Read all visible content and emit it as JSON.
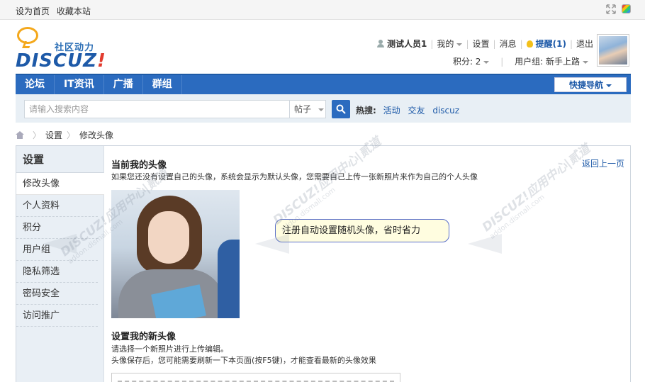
{
  "topbar": {
    "set_home": "设为首页",
    "bookmark": "收藏本站"
  },
  "logo": {
    "tagline": "社区动力",
    "wordmark": "DISCUZ",
    "bang": "!"
  },
  "user": {
    "name": "测试人员1",
    "mine": "我的",
    "settings": "设置",
    "messages": "消息",
    "remind": "提醒(1)",
    "logout": "退出",
    "points": "积分: 2",
    "usergroup": "用户组: 新手上路"
  },
  "nav": {
    "items": [
      "论坛",
      "IT资讯",
      "广播",
      "群组"
    ],
    "quick": "快捷导航"
  },
  "search": {
    "placeholder": "请输入搜索内容",
    "type": "帖子",
    "hot_label": "热搜:",
    "hot": [
      "活动",
      "交友",
      "discuz"
    ]
  },
  "breadcrumb": [
    "设置",
    "修改头像"
  ],
  "sidebar": {
    "title": "设置",
    "items": [
      "修改头像",
      "个人资料",
      "积分",
      "用户组",
      "隐私筛选",
      "密码安全",
      "访问推广"
    ]
  },
  "content": {
    "current_title": "当前我的头像",
    "current_desc": "如果您还没有设置自己的头像，系统会显示为默认头像，您需要自己上传一张新照片来作为自己的个人头像",
    "back": "返回上一页",
    "tooltip": "注册自动设置随机头像，省时省力",
    "new_title": "设置我的新头像",
    "new_desc1": "请选择一个新照片进行上传编辑。",
    "new_desc2": "头像保存后，您可能需要刷新一下本页面(按F5键)，才能查看最新的头像效果"
  },
  "watermark": {
    "text": "DISCUZ!应用中心|贰道",
    "sub": "addon.dismall.com"
  },
  "colors": {
    "nav_blue": "#2b6bbf",
    "link_blue": "#1e5aa8",
    "sidebar_bg": "#e9eff5",
    "tooltip_bg": "#fffde0"
  }
}
